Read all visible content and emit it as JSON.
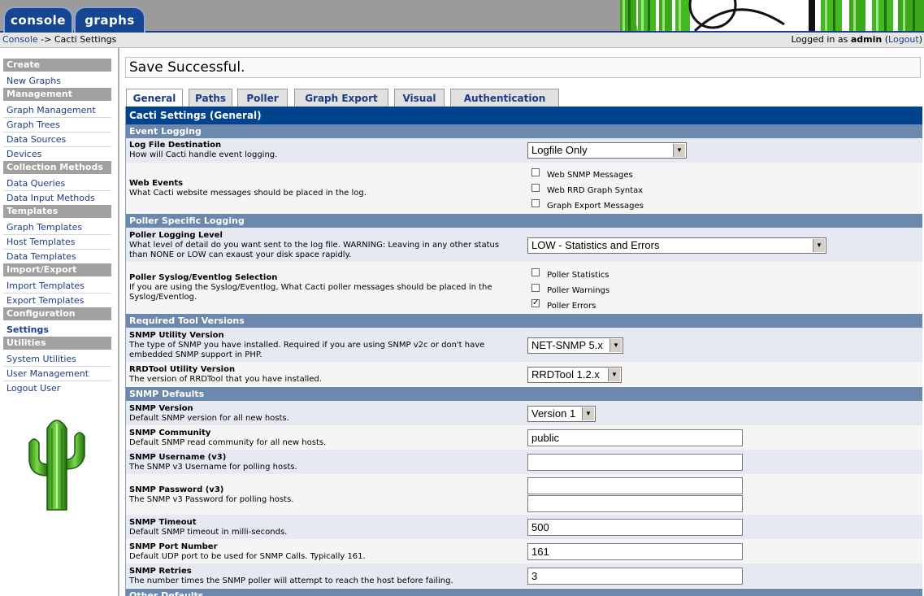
{
  "nav": {
    "console_tab": "console",
    "graphs_tab": "graphs"
  },
  "breadcrumb": {
    "console": "Console",
    "arrow": "->",
    "current": "Cacti Settings"
  },
  "login": {
    "prefix": "Logged in as",
    "user": "admin",
    "logout_open": "(",
    "logout": "Logout",
    "logout_close": ")"
  },
  "sidebar": {
    "create_header": "Create",
    "new_graphs": "New Graphs",
    "management_header": "Management",
    "graph_management": "Graph Management",
    "graph_trees": "Graph Trees",
    "data_sources": "Data Sources",
    "devices": "Devices",
    "collection_header": "Collection Methods",
    "data_queries": "Data Queries",
    "data_input_methods": "Data Input Methods",
    "templates_header": "Templates",
    "graph_templates": "Graph Templates",
    "host_templates": "Host Templates",
    "data_templates": "Data Templates",
    "import_export_header": "Import/Export",
    "import_templates": "Import Templates",
    "export_templates": "Export Templates",
    "configuration_header": "Configuration",
    "settings": "Settings",
    "utilities_header": "Utilities",
    "system_utilities": "System Utilities",
    "user_management": "User Management",
    "logout_user": "Logout User"
  },
  "status": {
    "message": "Save Successful."
  },
  "tabs": {
    "general": "General",
    "paths": "Paths",
    "poller": "Poller",
    "graph_export": "Graph Export",
    "visual": "Visual",
    "authentication": "Authentication"
  },
  "table": {
    "title": "Cacti Settings (General)",
    "event_logging": "Event Logging",
    "log_file_destination": {
      "label": "Log File Destination",
      "desc": "How will Cacti handle event logging.",
      "value": "Logfile Only"
    },
    "web_events": {
      "label": "Web Events",
      "desc": "What Cacti website messages should be placed in the log.",
      "opt1": "Web SNMP Messages",
      "opt2": "Web RRD Graph Syntax",
      "opt3": "Graph Export Messages"
    },
    "poller_specific_logging": "Poller Specific Logging",
    "poller_logging_level": {
      "label": "Poller Logging Level",
      "desc": "What level of detail do you want sent to the log file. WARNING: Leaving in any other status than NONE or LOW can exaust your disk space rapidly.",
      "value": "LOW - Statistics and Errors"
    },
    "poller_syslog": {
      "label": "Poller Syslog/Eventlog Selection",
      "desc": "If you are using the Syslog/Eventlog, What Cacti poller messages should be placed in the Syslog/Eventlog.",
      "opt1": "Poller Statistics",
      "opt2": "Poller Warnings",
      "opt3": "Poller Errors",
      "opt3_checked": true
    },
    "required_tool_versions": "Required Tool Versions",
    "snmp_utility_version": {
      "label": "SNMP Utility Version",
      "desc": "The type of SNMP you have installed. Required if you are using SNMP v2c or don't have embedded SNMP support in PHP.",
      "value": "NET-SNMP 5.x"
    },
    "rrdtool_utility_version": {
      "label": "RRDTool Utility Version",
      "desc": "The version of RRDTool that you have installed.",
      "value": "RRDTool 1.2.x"
    },
    "snmp_defaults": "SNMP Defaults",
    "snmp_version": {
      "label": "SNMP Version",
      "desc": "Default SNMP version for all new hosts.",
      "value": "Version 1"
    },
    "snmp_community": {
      "label": "SNMP Community",
      "desc": "Default SNMP read community for all new hosts.",
      "value": "public"
    },
    "snmp_username": {
      "label": "SNMP Username (v3)",
      "desc": "The SNMP v3 Username for polling hosts.",
      "value": ""
    },
    "snmp_password": {
      "label": "SNMP Password (v3)",
      "desc": "The SNMP v3 Password for polling hosts.",
      "value": "",
      "confirm": ""
    },
    "snmp_timeout": {
      "label": "SNMP Timeout",
      "desc": "Default SNMP timeout in milli-seconds.",
      "value": "500"
    },
    "snmp_port": {
      "label": "SNMP Port Number",
      "desc": "Default UDP port to be used for SNMP Calls. Typically 161.",
      "value": "161"
    },
    "snmp_retries": {
      "label": "SNMP Retries",
      "desc": "The number times the SNMP poller will attempt to reach the host before failing.",
      "value": "3"
    },
    "other_defaults": "Other Defaults"
  }
}
